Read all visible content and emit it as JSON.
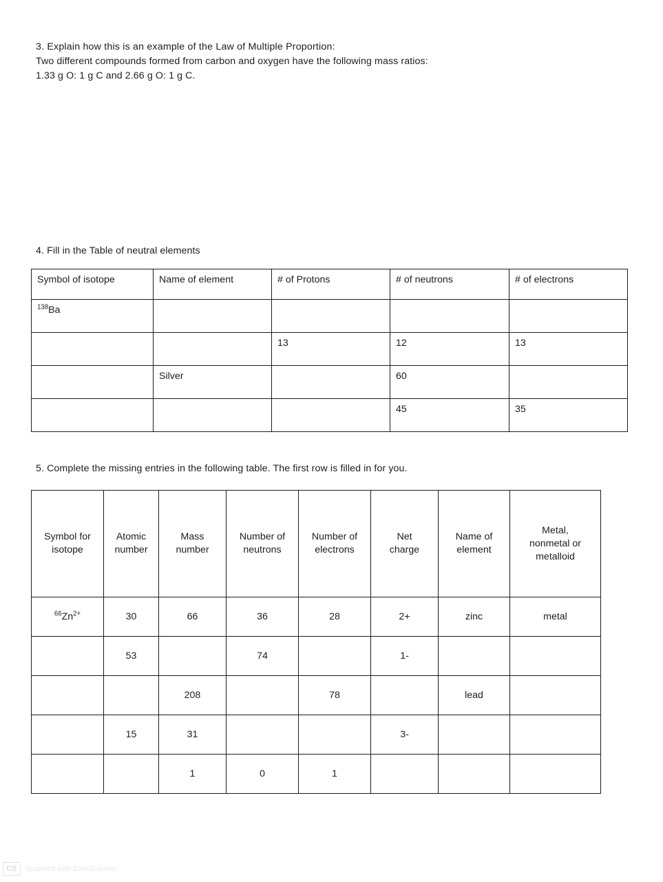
{
  "document": {
    "background_color": "#ffffff",
    "text_color": "#1d1d1d",
    "border_color": "#1b1b1b"
  },
  "question3": {
    "line1": "3.  Explain how this is an example of the Law of Multiple Proportion:",
    "line2": "Two different compounds formed from carbon and oxygen have the following mass ratios:",
    "line3": "1.33 g O: 1 g C and 2.66 g O: 1 g C."
  },
  "question4": {
    "prompt": "4.  Fill in the Table of neutral elements",
    "table": {
      "headers": [
        "Symbol of isotope",
        "Name of element",
        "# of Protons",
        "# of neutrons",
        "# of electrons"
      ],
      "rows": [
        {
          "symbol_sup": "138",
          "symbol_base": "Ba",
          "name": "",
          "protons": "",
          "neutrons": "",
          "electrons": ""
        },
        {
          "symbol_sup": "",
          "symbol_base": "",
          "name": "",
          "protons": "13",
          "neutrons": "12",
          "electrons": "13"
        },
        {
          "symbol_sup": "",
          "symbol_base": "",
          "name": "Silver",
          "protons": "",
          "neutrons": "60",
          "electrons": ""
        },
        {
          "symbol_sup": "",
          "symbol_base": "",
          "name": "",
          "protons": "",
          "neutrons": "45",
          "electrons": "35"
        }
      ]
    }
  },
  "question5": {
    "prompt": "5.  Complete the missing entries in the following table. The first row is filled in for you.",
    "table": {
      "headers": [
        "Symbol for\nisotope",
        "Atomic\nnumber",
        "Mass\nnumber",
        "Number of\nneutrons",
        "Number of\nelectrons",
        "Net\ncharge",
        "Name of\nelement",
        "Metal,\nnonmetal or\nmetalloid"
      ],
      "header_lines": [
        [
          "Symbol for",
          "isotope"
        ],
        [
          "Atomic",
          "number"
        ],
        [
          "Mass",
          "number"
        ],
        [
          "Number of",
          "neutrons"
        ],
        [
          "Number of",
          "electrons"
        ],
        [
          "Net",
          "charge"
        ],
        [
          "Name of",
          "element"
        ],
        [
          "Metal,",
          "nonmetal or",
          "metalloid"
        ]
      ],
      "rows": [
        {
          "symbol_mass_sup": "66",
          "symbol_base": "Zn",
          "symbol_charge_sup": "2+",
          "atomic_number": "30",
          "mass_number": "66",
          "neutrons": "36",
          "electrons": "28",
          "net_charge": "2+",
          "element_name": "zinc",
          "classification": "metal"
        },
        {
          "symbol_mass_sup": "",
          "symbol_base": "",
          "symbol_charge_sup": "",
          "atomic_number": "53",
          "mass_number": "",
          "neutrons": "74",
          "electrons": "",
          "net_charge": "1-",
          "element_name": "",
          "classification": ""
        },
        {
          "symbol_mass_sup": "",
          "symbol_base": "",
          "symbol_charge_sup": "",
          "atomic_number": "",
          "mass_number": "208",
          "neutrons": "",
          "electrons": "78",
          "net_charge": "",
          "element_name": "lead",
          "classification": ""
        },
        {
          "symbol_mass_sup": "",
          "symbol_base": "",
          "symbol_charge_sup": "",
          "atomic_number": "15",
          "mass_number": "31",
          "neutrons": "",
          "electrons": "",
          "net_charge": "3-",
          "element_name": "",
          "classification": ""
        },
        {
          "symbol_mass_sup": "",
          "symbol_base": "",
          "symbol_charge_sup": "",
          "atomic_number": "",
          "mass_number": "1",
          "neutrons": "0",
          "electrons": "1",
          "net_charge": "",
          "element_name": "",
          "classification": ""
        }
      ]
    }
  },
  "watermark": {
    "logo_text": "CS",
    "caption": "Scanned with CamScanner"
  }
}
